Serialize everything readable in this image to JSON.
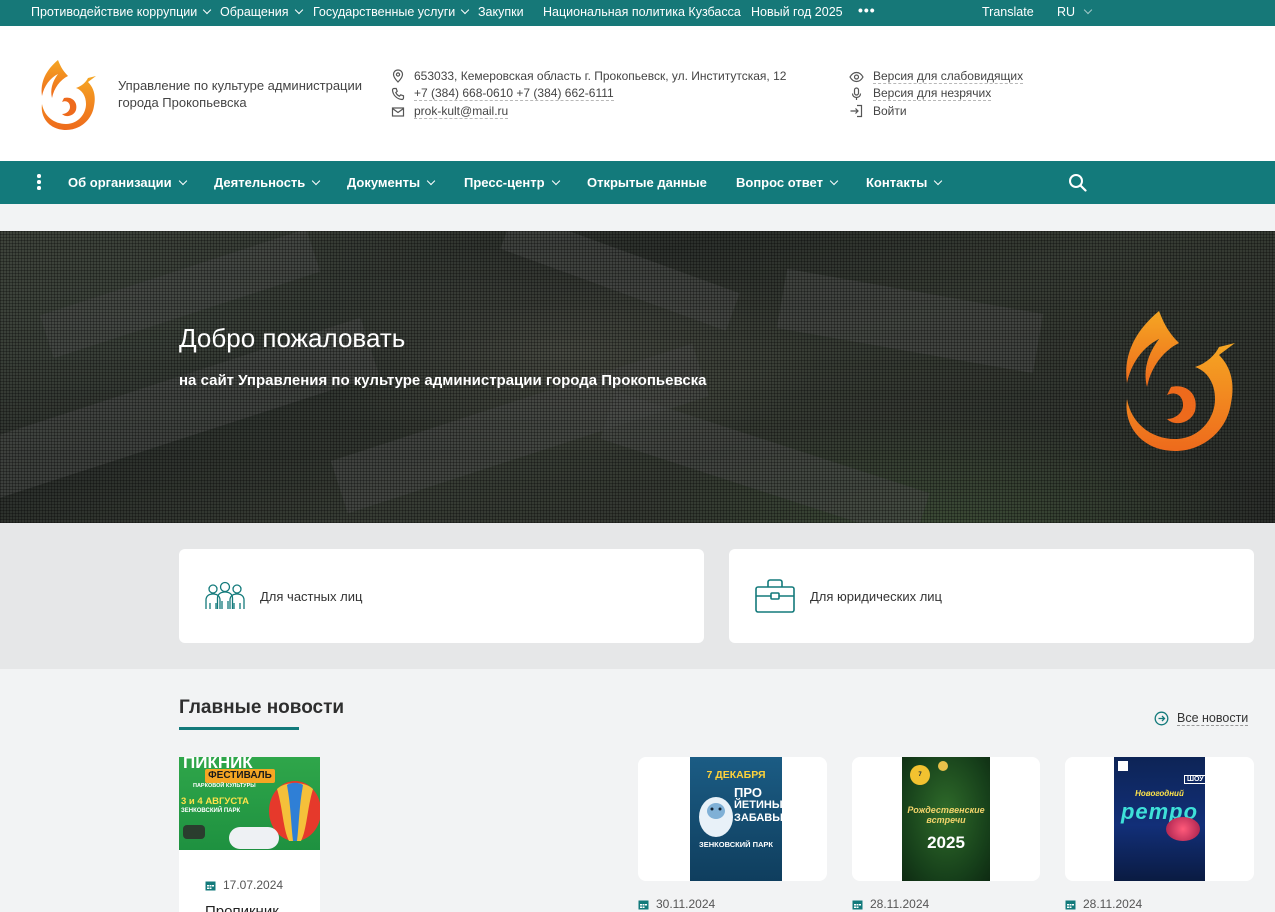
{
  "topbar": {
    "items": [
      {
        "label": "Противодействие коррупции",
        "dropdown": true
      },
      {
        "label": "Обращения",
        "dropdown": true
      },
      {
        "label": "Государственные услуги",
        "dropdown": true
      },
      {
        "label": "Закупки",
        "dropdown": false
      },
      {
        "label": "Национальная политика Кузбасса",
        "dropdown": false
      },
      {
        "label": "Новый год 2025",
        "dropdown": false
      }
    ],
    "more": "•••",
    "translate": "Translate",
    "lang": "RU"
  },
  "header": {
    "org_name": "Управление по культуре администрации города Прокопьевска",
    "address": "653033, Кемеровская область г. Прокопьевск, ул. Институтская, 12",
    "phone": "+7 (384) 668-0610 +7 (384) 662-6111",
    "email": "prok-kult@mail.ru",
    "low_vision": "Версия для слабовидящих",
    "hearing": "Версия для незрячих",
    "login": "Войти"
  },
  "mainnav": {
    "items": [
      {
        "label": "Об организации",
        "dropdown": true
      },
      {
        "label": "Деятельность",
        "dropdown": true
      },
      {
        "label": "Документы",
        "dropdown": true
      },
      {
        "label": "Пресс-центр",
        "dropdown": true
      },
      {
        "label": "Открытые данные",
        "dropdown": false
      },
      {
        "label": "Вопрос ответ",
        "dropdown": true
      },
      {
        "label": "Контакты",
        "dropdown": true
      }
    ]
  },
  "hero": {
    "title": "Добро пожаловать",
    "subtitle": "на сайт Управления по культуре администрации города Прокопьевска"
  },
  "services": [
    {
      "label": "Для частных лиц",
      "icon": "people-icon"
    },
    {
      "label": "Для юридических лиц",
      "icon": "briefcase-icon"
    }
  ],
  "news": {
    "title": "Главные новости",
    "all_news": "Все новости",
    "items": [
      {
        "date": "17.07.2024",
        "title": "Пропикник",
        "poster": {
          "line1": "ПИКНИК",
          "line2": "ФЕСТИВАЛЬ",
          "line3": "ПАРКОВОЙ КУЛЬТУРЫ",
          "line4": "3 и 4 АВГУСТА",
          "line5": "ЗЕНКОВСКИЙ ПАРК"
        }
      },
      {
        "date": "30.11.2024",
        "poster": {
          "line1": "7 ДЕКАБРЯ",
          "line2": "ПРО",
          "line3": "ЙЕТИНЫ",
          "line4": "ЗАБАВЫ",
          "line5": "ЗЕНКОВСКИЙ ПАРК"
        }
      },
      {
        "date": "28.11.2024",
        "poster": {
          "line1": "Рождественские встречи",
          "line2": "2025"
        }
      },
      {
        "date": "28.11.2024",
        "poster": {
          "line1": "Новогодний",
          "line2": "ретро",
          "line3": "ШОУ"
        }
      }
    ]
  },
  "colors": {
    "primary": "#137a7b",
    "topbar": "#167878",
    "logo_orange": "#f07a1f",
    "logo_yellow": "#f5a623"
  }
}
